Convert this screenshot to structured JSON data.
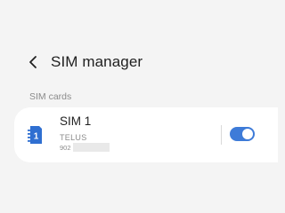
{
  "header": {
    "back_icon": "chevron-left-icon",
    "title": "SIM manager"
  },
  "sim_section": {
    "label": "SIM cards",
    "cards": [
      {
        "icon": "sim-card-icon",
        "icon_number": "1",
        "name": "SIM 1",
        "carrier": "TELUS",
        "number_prefix": "902",
        "enabled": true
      }
    ]
  },
  "colors": {
    "accent": "#3e7bd8",
    "background": "#f4f4f4",
    "card": "#ffffff",
    "sim_icon": "#2f6fd1"
  }
}
